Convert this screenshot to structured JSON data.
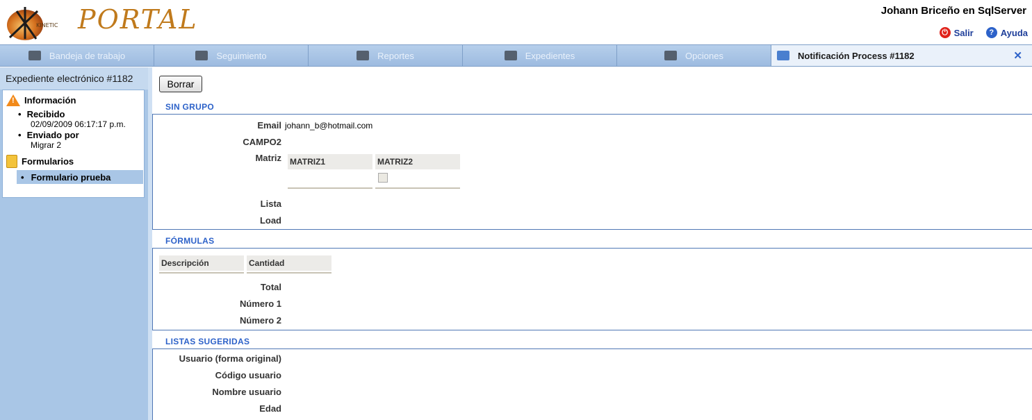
{
  "header": {
    "logo_small": "KINETIC",
    "logo_text": "PORTAL",
    "user_line": "Johann Briceño en SqlServer",
    "links": {
      "salir": "Salir",
      "ayuda": "Ayuda"
    }
  },
  "tabs": [
    {
      "label": "Bandeja de trabajo",
      "icon": "tray-icon"
    },
    {
      "label": "Seguimiento",
      "icon": "tracking-icon"
    },
    {
      "label": "Reportes",
      "icon": "reports-icon"
    },
    {
      "label": "Expedientes",
      "icon": "folders-icon"
    },
    {
      "label": "Opciones",
      "icon": "options-icon"
    },
    {
      "label": "Notificación Process #1182",
      "icon": "notification-icon",
      "active": true
    }
  ],
  "sidebar": {
    "title": "Expediente electrónico #1182",
    "info_section": "Información",
    "recibido_label": "Recibido",
    "recibido_value": "02/09/2009 06:17:17 p.m.",
    "enviado_label": "Enviado por",
    "enviado_value": "Migrar 2",
    "forms_section": "Formularios",
    "selected_form": "Formulario prueba"
  },
  "main": {
    "borrar_button": "Borrar",
    "group1": {
      "title": "SIN GRUPO",
      "email_label": "Email",
      "email_value": "johann_b@hotmail.com",
      "campo2_label": "CAMPO2",
      "matriz_label": "Matriz",
      "matriz_col1": "MATRIZ1",
      "matriz_col2": "MATRIZ2",
      "lista_label": "Lista",
      "load_label": "Load"
    },
    "group2": {
      "title": "FÓRMULAS",
      "col1": "Descripción",
      "col2": "Cantidad",
      "total_label": "Total",
      "numero1_label": "Número 1",
      "numero2_label": "Número 2"
    },
    "group3": {
      "title": "LISTAS SUGERIDAS",
      "usuario_label": "Usuario (forma original)",
      "codigo_label": "Código usuario",
      "nombre_label": "Nombre usuario",
      "edad_label": "Edad"
    }
  },
  "colors": {
    "accent_blue": "#2d62c9",
    "tab_bar": "#a9c6e6",
    "logo_orange": "#c07a1c",
    "warning": "#f28a1a"
  }
}
